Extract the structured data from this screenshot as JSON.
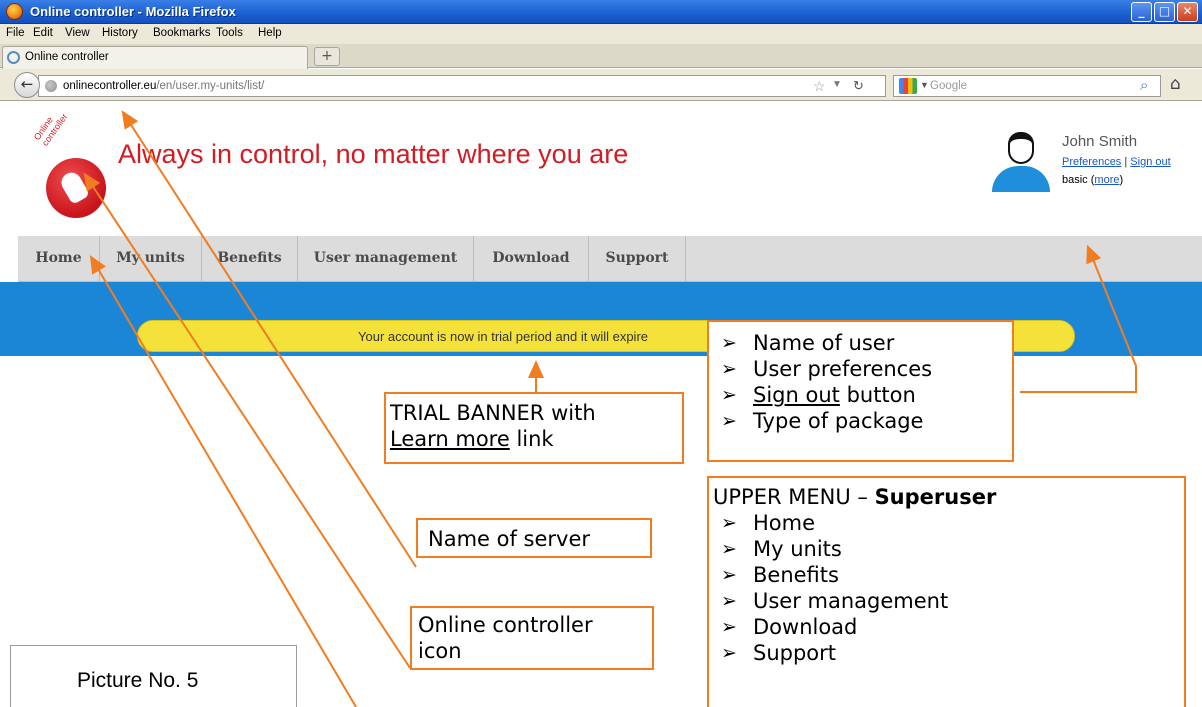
{
  "browser": {
    "window_title": "Online controller - Mozilla Firefox",
    "window_buttons": {
      "minimize": "_",
      "maximize": "□",
      "close": "✕"
    },
    "menu": [
      "File",
      "Edit",
      "View",
      "History",
      "Bookmarks",
      "Tools",
      "Help"
    ],
    "tab_label": "Online controller",
    "new_tab": "+",
    "back": "←",
    "url_host": "onlinecontroller.eu",
    "url_path": "/en/user.my-units/list/",
    "search_placeholder": "Google",
    "home_icon": "⌂"
  },
  "site": {
    "logo_text": "Online controller",
    "tagline": "Always in control, no matter where you are",
    "user": {
      "name": "John Smith",
      "preferences": "Preferences",
      "separator": "|",
      "sign_out": "Sign out",
      "package": "basic",
      "more": "more"
    },
    "nav": [
      "Home",
      "My units",
      "Benefits",
      "User management",
      "Download",
      "Support"
    ],
    "trial_text": "Your account is now in trial period and it will expire"
  },
  "annotations": {
    "user_box": [
      "Name of user",
      "User preferences",
      "Sign out",
      "button",
      "Type of package"
    ],
    "trial_box": {
      "line1": "TRIAL BANNER with",
      "link": "Learn more",
      "line2_suffix": " link"
    },
    "upper_menu": {
      "prefix": "UPPER MENU – ",
      "role": "Superuser",
      "items": [
        "Home",
        "My units",
        "Benefits",
        "User management",
        "Download",
        "Support"
      ]
    },
    "server_box": "Name of server",
    "icon_box": [
      "Online controller",
      "icon"
    ],
    "picture_label": "Picture No. 5"
  },
  "colors": {
    "accent_orange": "#f07d22",
    "brand_red": "#d11c23",
    "band_blue": "#1c86d6",
    "banner_yellow": "#f4e23b"
  }
}
